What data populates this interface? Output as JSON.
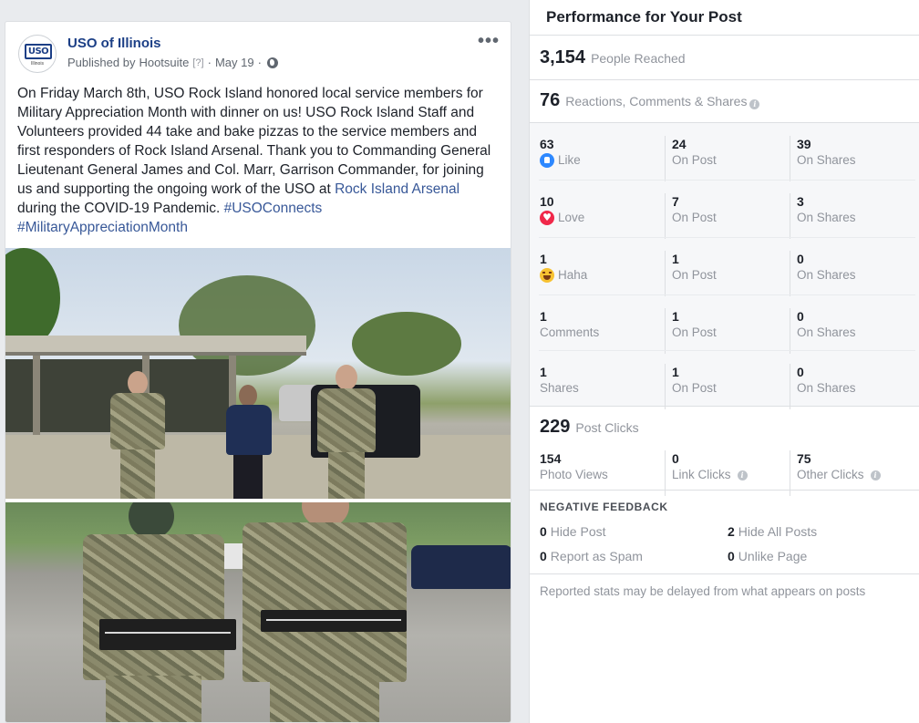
{
  "post": {
    "page_name": "USO of Illinois",
    "avatar_text": "USO",
    "avatar_subtext": "Illinois",
    "published_by_prefix": "Published by",
    "publisher": "Hootsuite",
    "publisher_help": "[?]",
    "separator": "·",
    "date": "May 19",
    "menu_label": "•••",
    "text_part1": "On Friday March 8th, USO Rock Island honored local service members for Military Appreciation Month with dinner on us! USO Rock Island Staff and Volunteers provided 44 take and bake pizzas to the service members and first responders of Rock Island Arsenal. Thank you to Commanding General Lieutenant General James and Col. Marr, Garrison Commander, for joining us and supporting the ongoing work of the USO at ",
    "link_rock_island": "Rock Island Arsenal",
    "text_part2": " during the COVID-19 Pandemic. ",
    "hashtag1": "#USOConnects",
    "hashtag2": "#MilitaryAppreciationMonth"
  },
  "performance": {
    "title": "Performance for Your Post",
    "people_reached": {
      "value": "3,154",
      "label": "People Reached"
    },
    "engagement": {
      "value": "76",
      "label": "Reactions, Comments & Shares"
    },
    "rows": [
      {
        "total": "63",
        "label": "Like",
        "icon": "like-icon",
        "on_post": "24",
        "on_post_label": "On Post",
        "on_shares": "39",
        "on_shares_label": "On Shares"
      },
      {
        "total": "10",
        "label": "Love",
        "icon": "love-icon",
        "on_post": "7",
        "on_post_label": "On Post",
        "on_shares": "3",
        "on_shares_label": "On Shares"
      },
      {
        "total": "1",
        "label": "Haha",
        "icon": "haha-icon",
        "on_post": "1",
        "on_post_label": "On Post",
        "on_shares": "0",
        "on_shares_label": "On Shares"
      },
      {
        "total": "1",
        "label": "Comments",
        "on_post": "1",
        "on_post_label": "On Post",
        "on_shares": "0",
        "on_shares_label": "On Shares"
      },
      {
        "total": "1",
        "label": "Shares",
        "on_post": "1",
        "on_post_label": "On Post",
        "on_shares": "0",
        "on_shares_label": "On Shares"
      }
    ],
    "post_clicks": {
      "value": "229",
      "label": "Post Clicks"
    },
    "clicks": [
      {
        "value": "154",
        "label": "Photo Views"
      },
      {
        "value": "0",
        "label": "Link Clicks"
      },
      {
        "value": "75",
        "label": "Other Clicks"
      }
    ],
    "negative_feedback": {
      "title": "NEGATIVE FEEDBACK",
      "hide_post": {
        "value": "0",
        "label": "Hide Post"
      },
      "hide_all": {
        "value": "2",
        "label": "Hide All Posts"
      },
      "spam": {
        "value": "0",
        "label": "Report as Spam"
      },
      "unlike": {
        "value": "0",
        "label": "Unlike Page"
      }
    },
    "footnote": "Reported stats may be delayed from what appears on posts"
  }
}
